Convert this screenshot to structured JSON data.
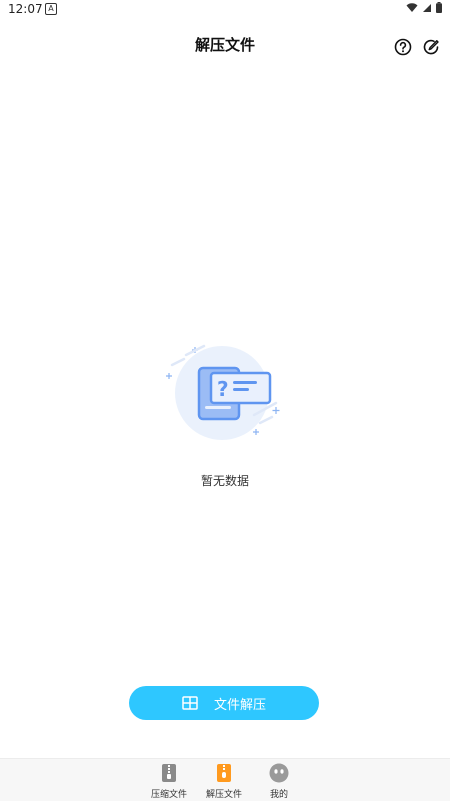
{
  "status": {
    "time": "12:07",
    "notification_letter": "A"
  },
  "header": {
    "title": "解压文件"
  },
  "empty_state": {
    "text": "暂无数据"
  },
  "action_button": {
    "label": "文件解压"
  },
  "bottom_nav": {
    "items": [
      {
        "label": "压缩文件",
        "icon": "zip-file-icon"
      },
      {
        "label": "解压文件",
        "icon": "extract-file-icon",
        "active": true
      },
      {
        "label": "我的",
        "icon": "profile-face-icon"
      }
    ]
  },
  "colors": {
    "accent": "#2ec7ff",
    "nav_active": "#ff9a1f",
    "illustration": "#5f95f0"
  }
}
